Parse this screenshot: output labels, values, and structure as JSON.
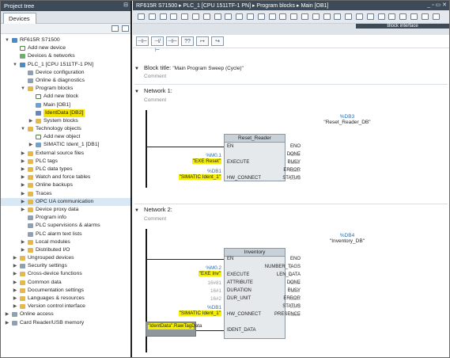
{
  "project_tree": {
    "title": "Project tree",
    "tab": "Devices",
    "items": [
      {
        "label": "RF615R S71500",
        "icon": "project-icon",
        "depth": 0,
        "arrow": "▼"
      },
      {
        "label": "Add new device",
        "icon": "add-icon",
        "depth": 1,
        "arrow": ""
      },
      {
        "label": "Devices & networks",
        "icon": "network-icon",
        "depth": 1,
        "arrow": ""
      },
      {
        "label": "PLC_1 [CPU 1511TF-1 PN]",
        "icon": "plc-icon",
        "depth": 1,
        "arrow": "▼"
      },
      {
        "label": "Device configuration",
        "icon": "device-config-icon",
        "depth": 2,
        "arrow": ""
      },
      {
        "label": "Online & diagnostics",
        "icon": "diagnostics-icon",
        "depth": 2,
        "arrow": ""
      },
      {
        "label": "Program blocks",
        "icon": "folder-icon",
        "depth": 2,
        "arrow": "▼"
      },
      {
        "label": "Add new block",
        "icon": "add-icon",
        "depth": 3,
        "arrow": ""
      },
      {
        "label": "Main [OB1]",
        "icon": "block-icon",
        "depth": 3,
        "arrow": ""
      },
      {
        "label": "IdentData [DB2]",
        "icon": "db-icon",
        "depth": 3,
        "arrow": "",
        "selected": true
      },
      {
        "label": "System blocks",
        "icon": "folder-icon",
        "depth": 3,
        "arrow": "▶"
      },
      {
        "label": "Technology objects",
        "icon": "folder-icon",
        "depth": 2,
        "arrow": "▼"
      },
      {
        "label": "Add new object",
        "icon": "add-icon",
        "depth": 3,
        "arrow": ""
      },
      {
        "label": "SIMATIC Ident_1 [DB1]",
        "icon": "tech-object-icon",
        "depth": 3,
        "arrow": "▶"
      },
      {
        "label": "External source files",
        "icon": "folder-icon",
        "depth": 2,
        "arrow": "▶"
      },
      {
        "label": "PLC tags",
        "icon": "folder-icon",
        "depth": 2,
        "arrow": "▶"
      },
      {
        "label": "PLC data types",
        "icon": "folder-icon",
        "depth": 2,
        "arrow": "▶"
      },
      {
        "label": "Watch and force tables",
        "icon": "folder-icon",
        "depth": 2,
        "arrow": "▶"
      },
      {
        "label": "Online backups",
        "icon": "folder-icon",
        "depth": 2,
        "arrow": "▶"
      },
      {
        "label": "Traces",
        "icon": "folder-icon",
        "depth": 2,
        "arrow": "▶"
      },
      {
        "label": "OPC UA communication",
        "icon": "folder-icon",
        "depth": 2,
        "arrow": "▶",
        "hover": true
      },
      {
        "label": "Device proxy data",
        "icon": "folder-icon",
        "depth": 2,
        "arrow": "▶"
      },
      {
        "label": "Program info",
        "icon": "info-icon",
        "depth": 2,
        "arrow": ""
      },
      {
        "label": "PLC supervisions & alarms",
        "icon": "alarm-icon",
        "depth": 2,
        "arrow": ""
      },
      {
        "label": "PLC alarm text lists",
        "icon": "list-icon",
        "depth": 2,
        "arrow": ""
      },
      {
        "label": "Local modules",
        "icon": "folder-icon",
        "depth": 2,
        "arrow": "▶"
      },
      {
        "label": "Distributed I/O",
        "icon": "folder-icon",
        "depth": 2,
        "arrow": "▶"
      },
      {
        "label": "Ungrouped devices",
        "icon": "folder-icon",
        "depth": 1,
        "arrow": "▶"
      },
      {
        "label": "Security settings",
        "icon": "security-icon",
        "depth": 1,
        "arrow": "▶"
      },
      {
        "label": "Cross-device functions",
        "icon": "folder-icon",
        "depth": 1,
        "arrow": "▶"
      },
      {
        "label": "Common data",
        "icon": "folder-icon",
        "depth": 1,
        "arrow": "▶"
      },
      {
        "label": "Documentation settings",
        "icon": "folder-icon",
        "depth": 1,
        "arrow": "▶"
      },
      {
        "label": "Languages & resources",
        "icon": "folder-icon",
        "depth": 1,
        "arrow": "▶"
      },
      {
        "label": "Version control interface",
        "icon": "folder-icon",
        "depth": 1,
        "arrow": "▶"
      },
      {
        "label": "Online access",
        "icon": "online-icon",
        "depth": 0,
        "arrow": "▶"
      },
      {
        "label": "Card Reader/USB memory",
        "icon": "usb-icon",
        "depth": 0,
        "arrow": "▶"
      }
    ]
  },
  "editor": {
    "breadcrumb": "RF615R S71500 ▸ PLC_1 [CPU 1511TF-1 PN] ▸ Program blocks ▸ Main [OB1]",
    "block_interface": "Block interface",
    "block_title_label": "Block title:",
    "block_title_value": "\"Main Program Sweep (Cycle)\"",
    "comment": "Comment",
    "ladder_buttons": [
      "-|  |-",
      "-|/|-",
      "-| |-",
      "??",
      "↦",
      "↪"
    ],
    "networks": [
      {
        "title": "Network 1:",
        "comment": "Comment",
        "db_number": "%DB3",
        "db_name": "\"Reset_Reader_DB\"",
        "block_name": "Reset_Reader",
        "pins_in": [
          "EN",
          "EXECUTE",
          "HW_CONNECT"
        ],
        "pins_out": [
          "ENO",
          "DONE",
          "BUSY",
          "ERROR",
          "STATUS"
        ],
        "out_values": [
          "",
          "false",
          "false",
          "false",
          "16#0"
        ],
        "in_operands": [
          {
            "addr": "%M0.1",
            "tag": "\"EXE Reset\""
          },
          {
            "addr": "%DB1",
            "tag": "\"SIMATIC Ident_1\""
          }
        ]
      },
      {
        "title": "Network 2:",
        "comment": "Comment",
        "db_number": "%DB4",
        "db_name": "\"Inventory_DB\"",
        "block_name": "Inventory",
        "pins_in": [
          "EN",
          "EXECUTE",
          "ATTRIBUTE",
          "DURATION",
          "DUR_UNIT",
          "HW_CONNECT",
          "IDENT_DATA"
        ],
        "pins_out": [
          "ENO",
          "NUMBER_TAGS",
          "LEN_DATA",
          "DONE",
          "BUSY",
          "ERROR",
          "STATUS",
          "PRESENCE"
        ],
        "out_values": [
          "",
          "0",
          "0",
          "false",
          "false",
          "false",
          "16#0",
          "false"
        ],
        "in_operands": [
          {
            "addr": "%M0.2",
            "tag": "\"EXE Inv\""
          },
          {
            "addr": "",
            "tag": "16#81"
          },
          {
            "addr": "",
            "tag": "16#1"
          },
          {
            "addr": "",
            "tag": "16#2"
          },
          {
            "addr": "%DB1",
            "tag": "\"SIMATIC Ident_1\""
          },
          {
            "addr": "",
            "tag": "\"IdentData\".RawTagData"
          }
        ]
      }
    ]
  }
}
